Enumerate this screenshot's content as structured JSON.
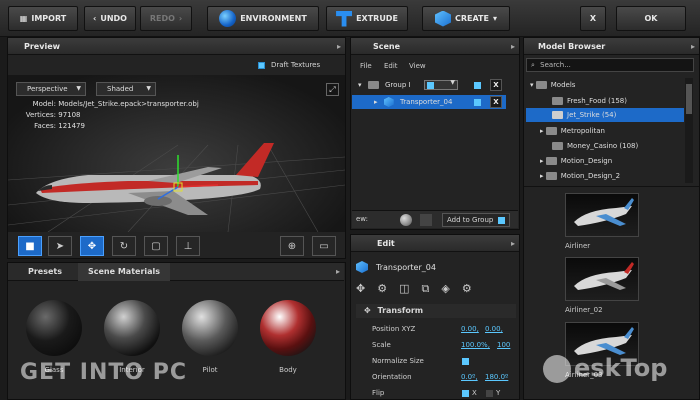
{
  "toolbar": {
    "import": "IMPORT",
    "undo": "UNDO",
    "redo": "REDO",
    "environment": "ENVIRONMENT",
    "extrude": "EXTRUDE",
    "create": "CREATE",
    "close": "X",
    "ok": "OK"
  },
  "preview": {
    "title": "Preview",
    "draft_textures": "Draft Textures",
    "camera_mode": "Perspective",
    "shading_mode": "Shaded",
    "model_label": "Model:",
    "model_value": "Models/Jet_Strike.epack>transporter.obj",
    "vertices_label": "Vertices:",
    "vertices_value": "97108",
    "faces_label": "Faces:",
    "faces_value": "121479"
  },
  "materials": {
    "tab_presets": "Presets",
    "tab_scene": "Scene Materials",
    "items": [
      "Glass",
      "Interior",
      "Pilot",
      "Body"
    ]
  },
  "scene": {
    "title": "Scene",
    "menu": [
      "File",
      "Edit",
      "View"
    ],
    "group_label": "Group I",
    "item_label": "Transporter_04",
    "view_label": "ew:",
    "add_to_group": "Add to Group"
  },
  "edit": {
    "title": "Edit",
    "object_name": "Transporter_04",
    "section": "Transform",
    "position_label": "Position XYZ",
    "position_values": [
      "0.00,",
      "0.00,"
    ],
    "scale_label": "Scale",
    "scale_values": [
      "100.0%,",
      "100"
    ],
    "normalize_label": "Normalize Size",
    "orientation_label": "Orientation",
    "orientation_values": [
      "0.0º,",
      "180.0º"
    ],
    "flip_label": "Flip",
    "flip_x": "X",
    "flip_y": "Y"
  },
  "browser": {
    "title": "Model Browser",
    "search_placeholder": "Search...",
    "tree": [
      {
        "label": "Models",
        "level": 0
      },
      {
        "label": "Fresh_Food (158)",
        "level": 1
      },
      {
        "label": "Jet_Strike (54)",
        "level": 1,
        "selected": true
      },
      {
        "label": "Metropolitan",
        "level": 1
      },
      {
        "label": "Money_Casino (108)",
        "level": 1
      },
      {
        "label": "Motion_Design",
        "level": 1
      },
      {
        "label": "Motion_Design_2",
        "level": 1
      }
    ],
    "thumbs": [
      "Airliner",
      "Airliner_02",
      "Airliner_03"
    ]
  },
  "watermark": {
    "left": "GET INTO PC",
    "right": "eskTop"
  },
  "colors": {
    "accent": "#1d6ac8",
    "highlight": "#5bc8ff"
  }
}
